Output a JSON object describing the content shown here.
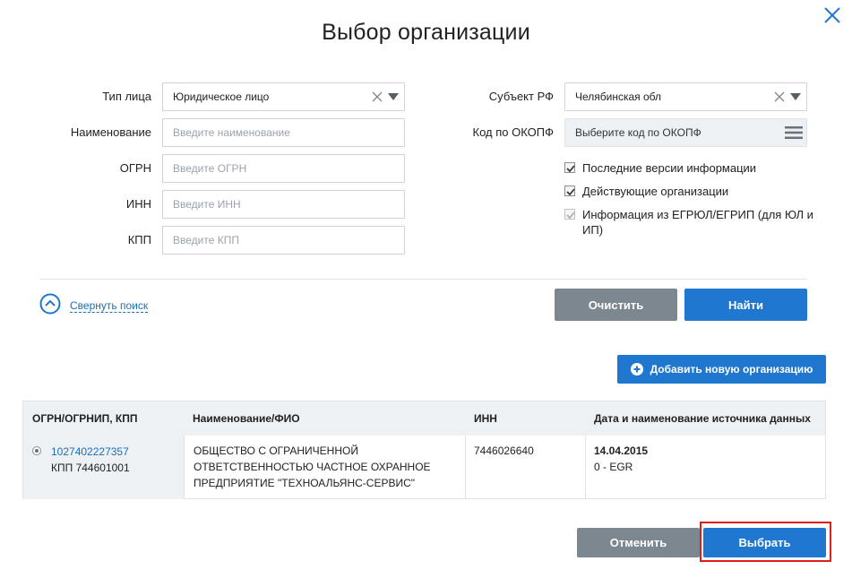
{
  "dialog": {
    "title": "Выбор организации",
    "close_icon": "close-icon"
  },
  "form": {
    "type": {
      "label": "Тип лица",
      "value": "Юридическое лицо"
    },
    "name": {
      "label": "Наименование",
      "placeholder": "Введите наименование"
    },
    "ogrn": {
      "label": "ОГРН",
      "placeholder": "Введите ОГРН"
    },
    "inn": {
      "label": "ИНН",
      "placeholder": "Введите ИНН"
    },
    "kpp": {
      "label": "КПП",
      "placeholder": "Введите КПП"
    },
    "subject": {
      "label": "Субъект РФ",
      "value": "Челябинская обл"
    },
    "okopf": {
      "label": "Код по ОКОПФ",
      "placeholder": "Выберите код по ОКОПФ"
    },
    "checkboxes": [
      {
        "label": "Последние версии информации",
        "checked": true,
        "disabled": false
      },
      {
        "label": "Действующие организации",
        "checked": true,
        "disabled": false
      },
      {
        "label_line1": "Информация из ЕГРЮЛ/ЕГРИП (для ЮЛ и",
        "label_line2": "ИП)",
        "checked": true,
        "disabled": true
      }
    ]
  },
  "actions": {
    "collapse_label": "Свернуть поиск",
    "clear_label": "Очистить",
    "find_label": "Найти",
    "add_label": "Добавить новую организацию"
  },
  "table": {
    "headers": [
      "ОГРН/ОГРНИП, КПП",
      "Наименование/ФИО",
      "ИНН",
      "Дата и наименование источника данных"
    ],
    "rows": [
      {
        "ogrn": "1027402227357",
        "kpp": "КПП 744601001",
        "name_lines": [
          "ОБЩЕСТВО С ОГРАНИЧЕННОЙ",
          "ОТВЕТСТВЕННОСТЬЮ ЧАСТНОЕ ОХРАННОЕ",
          "ПРЕДПРИЯТИЕ \"ТЕХНОАЛЬЯНС-СЕРВИС\""
        ],
        "inn": "7446026640",
        "date": "14.04.2015",
        "source": "0 - EGR",
        "selected": true
      }
    ]
  },
  "footer": {
    "cancel_label": "Отменить",
    "select_label": "Выбрать"
  },
  "colors": {
    "primary": "#1f77cf",
    "secondary": "#7d8790",
    "highlight": "#e21b1b",
    "link": "#1a6fb8"
  }
}
